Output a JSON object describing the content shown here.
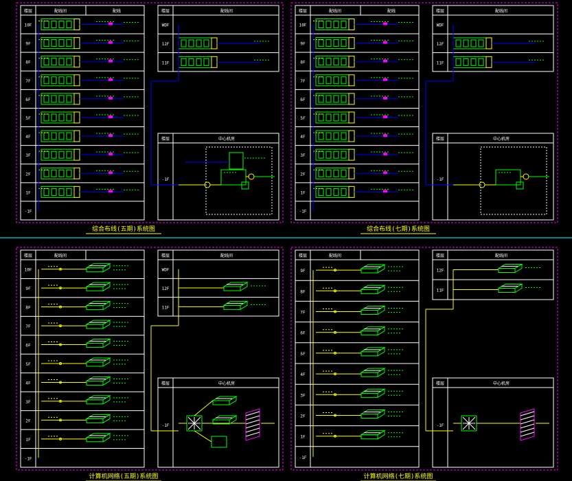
{
  "colors": {
    "background": "#000000",
    "frame": "#ff00ff",
    "grid": "#ffffff",
    "equipment": "#00ff00",
    "cable": "#ffff00",
    "riser": "#0000ff",
    "divider": "#00ffff",
    "tag": "#ff00ff"
  },
  "panels": [
    {
      "caption": "综合布线(五期)系统图",
      "headers": [
        "楼层",
        "配线间",
        "配线"
      ],
      "riser_header": [
        "楼层",
        "配线间"
      ],
      "center_header": [
        "楼层",
        "中心机房"
      ],
      "floors": [
        "10F",
        "9F",
        "8F",
        "7F",
        "6F",
        "5F",
        "4F",
        "3F",
        "2F",
        "1F",
        "-1F"
      ],
      "riser_floors": [
        "WDF",
        "12F",
        "11F"
      ],
      "center_floor": "-1F"
    },
    {
      "caption": "综合布线(七期)系统图",
      "headers": [
        "楼层",
        "配线间",
        "配线"
      ],
      "riser_header": [
        "楼层",
        "配线间"
      ],
      "center_header": [
        "楼层",
        "中心机房"
      ],
      "floors": [
        "10F",
        "9F",
        "8F",
        "7F",
        "6F",
        "5F",
        "4F",
        "3F",
        "2F",
        "1F",
        "-1F"
      ],
      "riser_floors": [
        "WDF",
        "12F",
        "11F"
      ],
      "center_floor": "-1F"
    },
    {
      "caption": "计算机网络(五期)系统图",
      "headers": [
        "楼层",
        "配线间"
      ],
      "riser_header": [
        "楼层",
        "配线间"
      ],
      "center_header": [
        "楼层",
        "中心机房"
      ],
      "floors": [
        "10F",
        "9F",
        "8F",
        "7F",
        "6F",
        "5F",
        "4F",
        "3F",
        "2F",
        "1F",
        "-1F"
      ],
      "riser_floors": [
        "WDF",
        "12F",
        "11F"
      ],
      "center_floor": "-1F"
    },
    {
      "caption": "计算机网络(七期)系统图",
      "headers": [
        "楼层",
        "配线间"
      ],
      "riser_header": [
        "楼层",
        "配线间"
      ],
      "center_header": [
        "楼层",
        "中心机房"
      ],
      "floors": [
        "9F",
        "8F",
        "7F",
        "6F",
        "5F",
        "4F",
        "3F",
        "2F",
        "1F",
        "-1F"
      ],
      "riser_floors": [
        "12F",
        "11F"
      ],
      "center_floor": "-1F"
    }
  ]
}
